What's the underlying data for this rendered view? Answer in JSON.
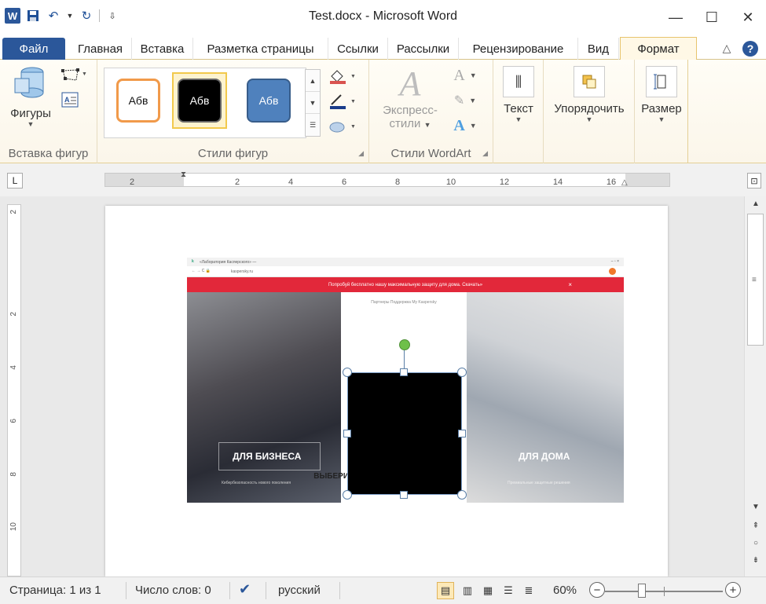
{
  "window": {
    "title": "Test.docx  -  Microsoft Word",
    "minimize": "—",
    "maximize": "☐",
    "close": "✕"
  },
  "qat": {
    "logo": "W",
    "save_icon": "save-icon",
    "undo_icon": "undo-icon",
    "redo_icon": "redo-icon"
  },
  "tabs": [
    {
      "label": "Файл"
    },
    {
      "label": "Главная"
    },
    {
      "label": "Вставка"
    },
    {
      "label": "Разметка страницы"
    },
    {
      "label": "Ссылки"
    },
    {
      "label": "Рассылки"
    },
    {
      "label": "Рецензирование"
    },
    {
      "label": "Вид"
    },
    {
      "label": "Формат"
    }
  ],
  "ribbon": {
    "insert_shapes": {
      "shapes_label": "Фигуры",
      "group_label": "Вставка фигур"
    },
    "shape_styles": {
      "styles": [
        {
          "text": "Абв"
        },
        {
          "text": "Абв"
        },
        {
          "text": "Абв"
        }
      ],
      "group_label": "Стили фигур"
    },
    "wordart": {
      "express_label_1": "Экспресс-",
      "express_label_2": "стили",
      "group_label": "Стили WordArt"
    },
    "text_label": "Текст",
    "arrange_label": "Упорядочить",
    "size_label": "Размер"
  },
  "ruler": {
    "corner": "L",
    "ticks": [
      "2",
      "2",
      "4",
      "6",
      "8",
      "10",
      "12",
      "14",
      "16"
    ],
    "vticks": [
      "2",
      "2",
      "4",
      "6",
      "8",
      "10"
    ]
  },
  "document": {
    "browser_tab": "«Лаборатория Касперского» —",
    "browser_url": "kaspersky.ru",
    "banner": "Попробуй бесплатно нашу максимальную защиту для дома. Скачать»",
    "nav": "Партнеры     Поддержка     My Kaspersky",
    "business_title": "ДЛЯ БИЗНЕСА",
    "business_sub": "Кибербезопасность нового поколения",
    "home_title": "ДЛЯ ДОМА",
    "home_sub": "Премиальные защитные решения",
    "choose_level": "ВЫБЕРИТЕ ВАШ УРОВЕНЬ ЗАЩИТЫ"
  },
  "status": {
    "page": "Страница: 1 из 1",
    "words": "Число слов: 0",
    "language": "русский",
    "zoom": "60%",
    "zoom_minus": "−",
    "zoom_plus": "+",
    "zoom_level": 0.6
  },
  "colors": {
    "accent": "#2b579a",
    "format_tab": "#e7c46d",
    "banner": "#e2283a"
  }
}
